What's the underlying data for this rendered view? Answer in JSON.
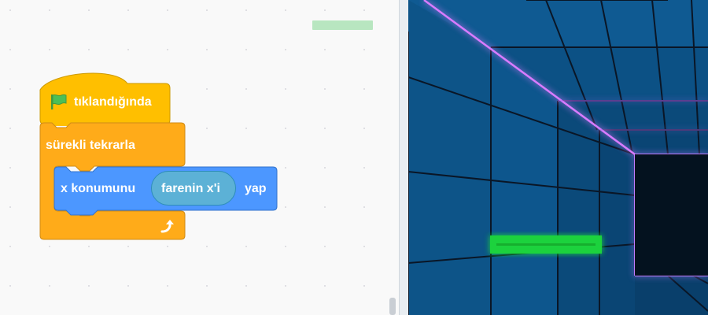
{
  "blocks": {
    "hat": {
      "label": "tıklandığında",
      "icon": "green-flag-icon"
    },
    "forever": {
      "label": "sürekli tekrarla",
      "loop_icon": "loop-arrow-icon"
    },
    "motion": {
      "label_prefix": "x konumunu",
      "reporter": "farenin x'i",
      "label_suffix": "yap"
    }
  },
  "colors": {
    "events": "#ffbf00",
    "control": "#ffab19",
    "motion": "#4c97ff",
    "sensing": "#5cb1d6",
    "stage_bg": "#0f5a92",
    "tunnel_end": "#04121f",
    "neon_edge": "#d97bff",
    "paddle": "#1ed23c"
  }
}
